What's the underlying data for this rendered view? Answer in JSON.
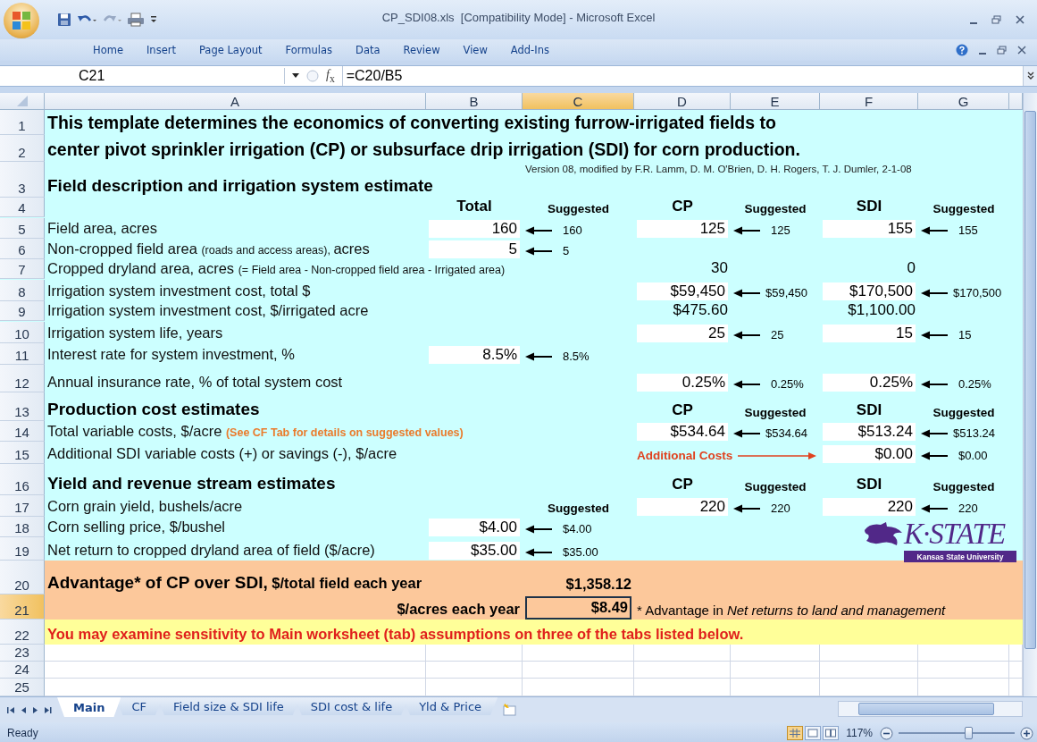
{
  "window": {
    "title": "CP_SDI08.xls  [Compatibility Mode] - Microsoft Excel"
  },
  "ribbon_tabs": [
    {
      "label": "Home"
    },
    {
      "label": "Insert"
    },
    {
      "label": "Page Layout"
    },
    {
      "label": "Formulas"
    },
    {
      "label": "Data"
    },
    {
      "label": "Review"
    },
    {
      "label": "View"
    },
    {
      "label": "Add-Ins"
    }
  ],
  "formula_bar": {
    "name_box": "C21",
    "insert_function": "*f*$_{x}$",
    "formula": "=C20/B5"
  },
  "sheet": {
    "columns": [
      {
        "label": "A",
        "selected": false
      },
      {
        "label": "B",
        "selected": false
      },
      {
        "label": "C",
        "selected": true
      },
      {
        "label": "D",
        "selected": false
      },
      {
        "label": "E",
        "selected": false
      },
      {
        "label": "F",
        "selected": false
      },
      {
        "label": "G",
        "selected": false
      }
    ],
    "rows": [
      {
        "number": "1",
        "kind": "main",
        "selected": false,
        "cells": {
          "a": {
            "kind": "title",
            "text": "This template determines the economics of converting existing furrow-irrigated fields to"
          }
        }
      },
      {
        "number": "2",
        "kind": "main",
        "selected": false,
        "cells": {
          "a": {
            "kind": "title",
            "text": "center pivot sprinkler irrigation (CP) or subsurface drip irrigation (SDI) for corn production."
          }
        }
      },
      {
        "number": "3",
        "kind": "main",
        "selected": false,
        "cells": {
          "a": {
            "kind": "section",
            "text": "Field description and irrigation system estimate"
          },
          "c": {
            "kind": "credit",
            "text": "Version 08, modified by F.R. Lamm, D. M. O'Brien, D. H. Rogers, T. J. Dumler, 2-1-08"
          }
        }
      },
      {
        "number": "4",
        "kind": "main",
        "selected": false,
        "cells": {
          "b": {
            "kind": "header",
            "text": "Total"
          },
          "c": {
            "kind": "subhead",
            "text": "Suggested"
          },
          "d": {
            "kind": "header",
            "text": "CP"
          },
          "e": {
            "kind": "subhead",
            "text": "Suggested"
          },
          "f": {
            "kind": "header",
            "text": "SDI"
          },
          "g": {
            "kind": "subhead",
            "text": "Suggested"
          }
        }
      },
      {
        "number": "5",
        "kind": "main",
        "selected": false,
        "cells": {
          "a": {
            "kind": "label",
            "text": "Field area, acres"
          },
          "b": {
            "kind": "input",
            "text": "160"
          },
          "c": {
            "kind": "suggested",
            "text": "160"
          },
          "d": {
            "kind": "input",
            "text": "125"
          },
          "e": {
            "kind": "suggested",
            "text": "125"
          },
          "f": {
            "kind": "input",
            "text": "155"
          },
          "g": {
            "kind": "suggested",
            "text": "155"
          }
        }
      },
      {
        "number": "6",
        "kind": "main",
        "selected": false,
        "cells": {
          "a": {
            "kind": "label",
            "parts": [
              {
                "kind": "normal",
                "text": "Non-cropped field area "
              },
              {
                "kind": "small",
                "text": "(roads and access areas), "
              },
              {
                "kind": "normal",
                "text": "acres"
              }
            ]
          },
          "b": {
            "kind": "input",
            "text": "5"
          },
          "c": {
            "kind": "suggested",
            "text": "5"
          }
        }
      },
      {
        "number": "7",
        "kind": "main",
        "selected": false,
        "cells": {
          "a": {
            "kind": "label",
            "parts": [
              {
                "kind": "normal",
                "text": "Cropped dryland area, acres "
              },
              {
                "kind": "small",
                "text": "(= Field area - Non-cropped field area - Irrigated area)"
              }
            ]
          },
          "d": {
            "kind": "value",
            "text": "30"
          },
          "f": {
            "kind": "value",
            "text": "0"
          }
        }
      },
      {
        "number": "8",
        "kind": "main",
        "selected": false,
        "cells": {
          "a": {
            "kind": "label",
            "text": "Irrigation system investment cost, total $"
          },
          "d": {
            "kind": "input",
            "text": "$59,450"
          },
          "e": {
            "kind": "suggested",
            "text": "$59,450"
          },
          "f": {
            "kind": "input",
            "text": "$170,500"
          },
          "g": {
            "kind": "suggested",
            "text": "$170,500"
          }
        }
      },
      {
        "number": "9",
        "kind": "main",
        "selected": false,
        "cells": {
          "a": {
            "kind": "label",
            "text": "Irrigation system investment cost, $/irrigated acre"
          },
          "d": {
            "kind": "value",
            "text": "$475.60"
          },
          "f": {
            "kind": "value",
            "text": "$1,100.00"
          }
        }
      },
      {
        "number": "10",
        "kind": "main",
        "selected": false,
        "cells": {
          "a": {
            "kind": "label",
            "text": "Irrigation system life, years"
          },
          "d": {
            "kind": "input",
            "text": "25"
          },
          "e": {
            "kind": "suggested",
            "text": "25"
          },
          "f": {
            "kind": "input",
            "text": "15"
          },
          "g": {
            "kind": "suggested",
            "text": "15"
          }
        }
      },
      {
        "number": "11",
        "kind": "main",
        "selected": false,
        "cells": {
          "a": {
            "kind": "label",
            "text": "Interest rate for system investment, %"
          },
          "b": {
            "kind": "input",
            "text": "8.5%"
          },
          "c": {
            "kind": "suggested",
            "text": "8.5%"
          }
        }
      },
      {
        "number": "12",
        "kind": "main",
        "selected": false,
        "cells": {
          "a": {
            "kind": "label",
            "text": "Annual insurance rate, % of total system cost"
          },
          "d": {
            "kind": "input",
            "text": "0.25%"
          },
          "e": {
            "kind": "suggested",
            "text": "0.25%"
          },
          "f": {
            "kind": "input",
            "text": "0.25%"
          },
          "g": {
            "kind": "suggested",
            "text": "0.25%"
          }
        }
      },
      {
        "number": "13",
        "kind": "main",
        "selected": false,
        "cells": {
          "a": {
            "kind": "section",
            "text": "Production cost estimates"
          },
          "d": {
            "kind": "header",
            "text": "CP"
          },
          "e": {
            "kind": "subhead",
            "text": "Suggested"
          },
          "f": {
            "kind": "header",
            "text": "SDI"
          },
          "g": {
            "kind": "subhead",
            "text": "Suggested"
          }
        }
      },
      {
        "number": "14",
        "kind": "main",
        "selected": false,
        "cells": {
          "a": {
            "kind": "label",
            "parts": [
              {
                "kind": "normal",
                "text": "Total variable costs, $/acre "
              },
              {
                "kind": "note",
                "text": "(See CF Tab for details on suggested values)"
              }
            ]
          },
          "d": {
            "kind": "input",
            "text": "$534.64"
          },
          "e": {
            "kind": "suggested",
            "text": "$534.64"
          },
          "f": {
            "kind": "input",
            "text": "$513.24"
          },
          "g": {
            "kind": "suggested",
            "text": "$513.24"
          }
        }
      },
      {
        "number": "15",
        "kind": "main",
        "selected": false,
        "cells": {
          "a": {
            "kind": "label",
            "text": "Additional SDI variable costs (+) or savings (-), $/acre"
          },
          "d": {
            "kind": "pointer",
            "text": "Additional Costs"
          },
          "f": {
            "kind": "input",
            "text": "$0.00"
          },
          "g": {
            "kind": "suggested",
            "text": "$0.00"
          }
        }
      },
      {
        "number": "16",
        "kind": "main",
        "selected": false,
        "cells": {
          "a": {
            "kind": "section",
            "text": "Yield and revenue stream estimates"
          },
          "d": {
            "kind": "header",
            "text": "CP"
          },
          "e": {
            "kind": "subhead",
            "text": "Suggested"
          },
          "f": {
            "kind": "header",
            "text": "SDI"
          },
          "g": {
            "kind": "subhead",
            "text": "Suggested"
          }
        }
      },
      {
        "number": "17",
        "kind": "main",
        "selected": false,
        "cells": {
          "a": {
            "kind": "label",
            "text": "Corn grain yield, bushels/acre"
          },
          "c": {
            "kind": "subhead",
            "text": "Suggested"
          },
          "d": {
            "kind": "input",
            "text": "220"
          },
          "e": {
            "kind": "suggested",
            "text": "220"
          },
          "f": {
            "kind": "input",
            "text": "220"
          },
          "g": {
            "kind": "suggested",
            "text": "220"
          }
        }
      },
      {
        "number": "18",
        "kind": "main",
        "selected": false,
        "cells": {
          "a": {
            "kind": "label",
            "text": "Corn selling price, $/bushel"
          },
          "b": {
            "kind": "input",
            "text": "$4.00"
          },
          "c": {
            "kind": "suggested",
            "text": "$4.00"
          }
        }
      },
      {
        "number": "19",
        "kind": "main",
        "selected": false,
        "cells": {
          "a": {
            "kind": "label",
            "text": "Net return to cropped dryland area of field ($/acre)"
          },
          "b": {
            "kind": "input",
            "text": "$35.00"
          },
          "c": {
            "kind": "suggested",
            "text": "$35.00"
          }
        }
      },
      {
        "number": "20",
        "kind": "result",
        "selected": false,
        "cells": {
          "a": {
            "kind": "result",
            "parts": [
              {
                "kind": "large",
                "text": "Advantage* of CP over SDI,"
              },
              {
                "kind": "normal",
                "text": " $/total field each year"
              }
            ]
          },
          "c": {
            "kind": "result-value",
            "text": "$1,358.12"
          }
        }
      },
      {
        "number": "21",
        "kind": "result",
        "selected": true,
        "cells": {
          "b": {
            "kind": "result-label",
            "text": "$/acres each year"
          },
          "c": {
            "kind": "result-value",
            "text": "$8.49"
          },
          "d": {
            "kind": "footnote",
            "text": "* Advantage in *Net returns to land and management*"
          }
        }
      },
      {
        "number": "22",
        "kind": "notice",
        "selected": false,
        "cells": {
          "a": {
            "kind": "warning",
            "text": "You may examine sensitivity to Main worksheet (tab) assumptions on three of the tabs listed below."
          }
        }
      },
      {
        "number": "23",
        "kind": "blank",
        "selected": false,
        "cells": {}
      },
      {
        "number": "24",
        "kind": "blank",
        "selected": false,
        "cells": {}
      },
      {
        "number": "25",
        "kind": "blank",
        "selected": false,
        "cells": {}
      }
    ],
    "logo": {
      "wordmark": "K·STATE",
      "subtitle": "Kansas State University"
    }
  },
  "sheet_tabs": [
    {
      "label": "Main",
      "selected": true
    },
    {
      "label": "CF",
      "selected": false
    },
    {
      "label": "Field size & SDI life",
      "selected": false
    },
    {
      "label": "SDI cost & life",
      "selected": false
    },
    {
      "label": "Yld & Price",
      "selected": false
    }
  ],
  "status_bar": {
    "status": "Ready",
    "views": [
      {
        "selected": true
      },
      {
        "selected": false
      },
      {
        "selected": false
      }
    ],
    "zoom": "117%",
    "zoom_slider": {
      "level": 0.6
    }
  }
}
